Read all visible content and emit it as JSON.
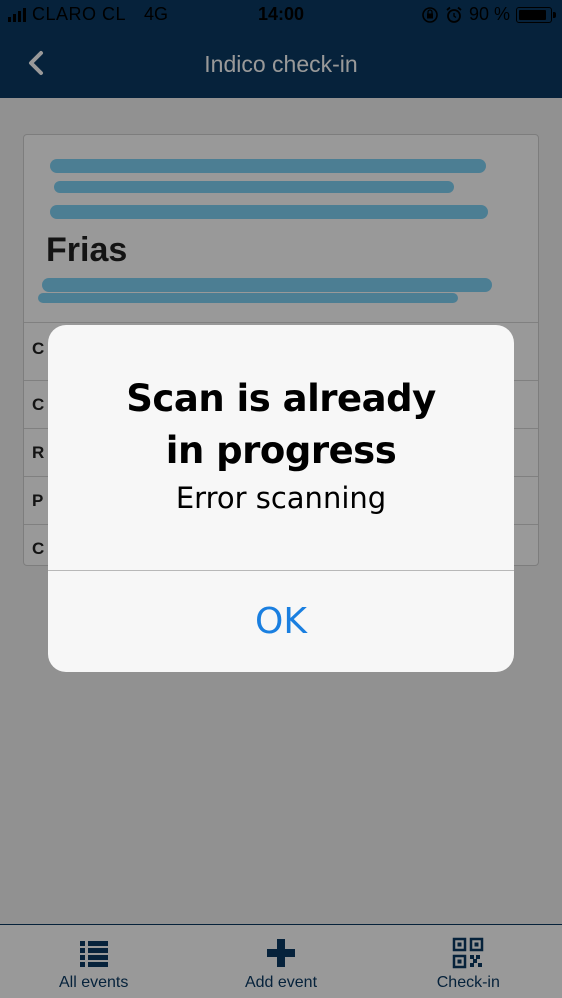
{
  "status_bar": {
    "carrier": "CLARO CL",
    "network": "4G",
    "time": "14:00",
    "battery_text": "90 %",
    "battery_level": 0.9
  },
  "nav": {
    "title": "Indico check-in",
    "back_icon": "chevron-left-icon"
  },
  "attendee_card": {
    "name_visible": "Frias",
    "rows": [
      {
        "label": "C"
      },
      {
        "label": "C"
      },
      {
        "label": "R"
      },
      {
        "label": "P"
      },
      {
        "label": "C"
      }
    ]
  },
  "alert": {
    "title": "Scan is already in progress",
    "message": "Error scanning",
    "ok_label": "OK"
  },
  "tab_bar": {
    "tabs": [
      {
        "label": "All events",
        "icon": "list-icon"
      },
      {
        "label": "Add event",
        "icon": "plus-icon"
      },
      {
        "label": "Check-in",
        "icon": "qr-code-icon"
      }
    ]
  },
  "colors": {
    "nav_background": "#0b3a63",
    "accent": "#1a7fe0",
    "redaction": "#7fd2f5"
  }
}
